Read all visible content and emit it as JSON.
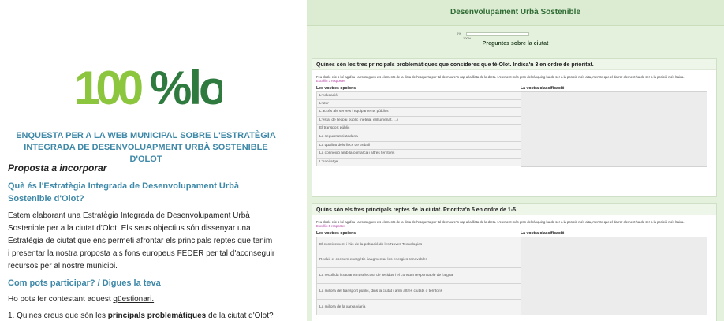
{
  "doc": {
    "logo_text": "100%lot",
    "subtitle": "ENQUESTA PER A LA WEB MUNICIPAL SOBRE L'ESTRATÈGIA INTEGRADA DE DESENVOLUAPMENT URBÀ SOSTENIBLE D'OLOT",
    "section_title": "Proposta a incorporar",
    "question_title": "Què és l'Estratègia Integrada de Desenvolupament Urbà Sostenible d'Olot?",
    "body": "Estem elaborant una Estratègia Integrada de Desenvolupament Urbà Sostenible per a la ciutat d'Olot. Els seus objectius són dissenyar una Estratègia de ciutat que ens permeti afrontar els principals reptes que tenim i presentar la nostra proposta als fons europeus FEDER per tal d'aconseguir recursos per al nostre municipi.",
    "participate_title": "Com pots participar? / Digues la teva",
    "link_prefix": "Ho pots fer contestant aquest ",
    "link_text": "qüestionari.",
    "item1_prefix": "1. Quines creus que són les ",
    "item1_bold": "principals problemàtiques",
    "item1_suffix": " de la ciutat d'Olot?"
  },
  "survey": {
    "title": "Desenvolupament Urbà Sostenible",
    "progress_pct": "0%",
    "progress_pct_bottom": "100%",
    "progress_value": 0,
    "page_subtitle": "Preguntes sobre la ciutat",
    "q1": {
      "text": "Quines són les tres principals problemàtiques que consideres que té Olot. Indica'n 3 en ordre de prioritat.",
      "help": "Feu doble clic o bé agafeu i arrossegueu els elements de la llista de l'esquerra per tal de moure'ls cap a la llista de la dreta. L'element més gran del rànquing ha de ser a la posició més alta, mentre que el darrer element ha de ser a la posició més baixa.",
      "pick": "Escolliu 3 respostes",
      "col_options": "Les vostres opcions",
      "col_rank": "La vostra classificació",
      "options": [
        "L'educació",
        "L'atur",
        "L'accés als serveis i equipaments públics",
        "L'estat de l'espai públic (neteja, enllumenat, ...)",
        "El transport públic",
        "La seguretat ciutadana",
        "La qualitat dels llocs de treball",
        "La connexió amb la comarca i altres territoris",
        "L'habitatge"
      ]
    },
    "q2": {
      "text": "Quins són els tres principals reptes de la ciutat. Prioritza'n 5 en ordre de 1-5.",
      "help": "Feu doble clic o bé agafeu i arrossegueu els elements de la llista de l'esquerra per tal de moure'ls cap a la llista de la dreta. L'element més gran del rànquing ha de ser a la posició més alta, mentre que el darrer element ha de ser a la posició més baixa.",
      "pick": "Escolliu 5 respostes",
      "col_options": "Les vostres opcions",
      "col_rank": "La vostra classificació",
      "options": [
        "El coneixement i l'ús de la població de les Noves Tecnologies",
        "Reduir el consum energètic i augmentar les energies renovables",
        "La recollida i tractament selectiva de residus i el consum responsable de l'aigua",
        "La millora del transport públic, dins la ciutat i amb altres ciutats o territoris",
        "La millora de la xarxa viària"
      ]
    }
  }
}
